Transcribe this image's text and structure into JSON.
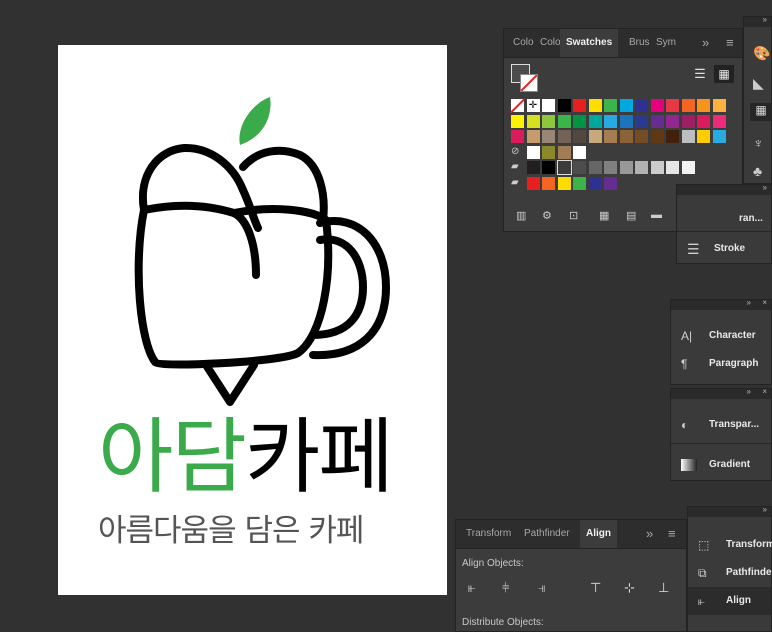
{
  "artboard": {
    "brand_green": "ㅇㅏ담",
    "title_green": "아담",
    "title_black": "카페",
    "subtitle": "아름다움을 담은 카페",
    "green": "#3aaa4a"
  },
  "swatches_panel": {
    "tabs": [
      "Colo",
      "Colo",
      "Swatches",
      "Brus",
      "Sym"
    ],
    "more_glyph": "»",
    "menu_glyph": "≡",
    "rows": [
      [
        "#ffffff",
        "#ffffff",
        "#ffffff",
        "#000000",
        "#e5201f",
        "#ffdd00",
        "#3cb44a",
        "#00a7e1",
        "#2e3192",
        "#e6007e",
        "#e63946",
        "#f26522",
        "#f7941d",
        "#fbb040"
      ],
      [
        "#fff200",
        "#d7df23",
        "#8dc63f",
        "#39b54a",
        "#009444",
        "#00a79d",
        "#27aae1",
        "#1c75bc",
        "#2b3990",
        "#662d91",
        "#92278f",
        "#9e1f63",
        "#da1c5c",
        "#ee2a7b"
      ],
      [
        "#d91d5c",
        "#c69c6d",
        "#998675",
        "#736357",
        "#534741",
        "#c8a97e",
        "#a67c52",
        "#8c6239",
        "#754c24",
        "#603913",
        "#42210b",
        "#bcbec0",
        "#ffcc00",
        "#29abe2"
      ],
      [
        "#ffffff",
        "#8a8a2a",
        "#a37c55",
        "#ffffff"
      ],
      [
        "#231f20",
        "#000000",
        "#3c3c3c",
        "#4d4d4d",
        "#666666",
        "#808080",
        "#999999",
        "#b3b3b3",
        "#cccccc",
        "#e6e6e6",
        "#f2f2f2"
      ],
      [
        "#e5201f",
        "#f26522",
        "#ffdd00",
        "#3cb44a",
        "#2e3192",
        "#662d91"
      ]
    ]
  },
  "right_strip": {
    "transform_partial": "ran...",
    "stroke": "Stroke"
  },
  "char_panel": {
    "character": "Character",
    "paragraph": "Paragraph"
  },
  "transp_panel": {
    "transparency": "Transpar...",
    "gradient": "Gradient"
  },
  "align_panel": {
    "tabs": [
      "Transform",
      "Pathfinder",
      "Align"
    ],
    "align_objects": "Align Objects:",
    "distribute_objects": "Distribute Objects:"
  },
  "collapsed_panel": {
    "transform": "Transform",
    "pathfinder": "Pathfinder",
    "align": "Align"
  },
  "mini_controls": {
    "expand": "»",
    "close": "×"
  }
}
